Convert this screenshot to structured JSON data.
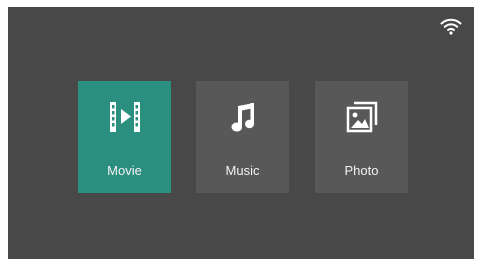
{
  "status_bar": {
    "wifi_icon": "wifi-icon"
  },
  "menu": {
    "selected_index": 0,
    "items": [
      {
        "label": "Movie",
        "icon": "movie-icon"
      },
      {
        "label": "Music",
        "icon": "music-note-icon"
      },
      {
        "label": "Photo",
        "icon": "photo-icon"
      }
    ]
  },
  "colors": {
    "background": "#484848",
    "tile": "#585858",
    "tile_selected": "#2a8f7f",
    "icon": "#ffffff"
  }
}
